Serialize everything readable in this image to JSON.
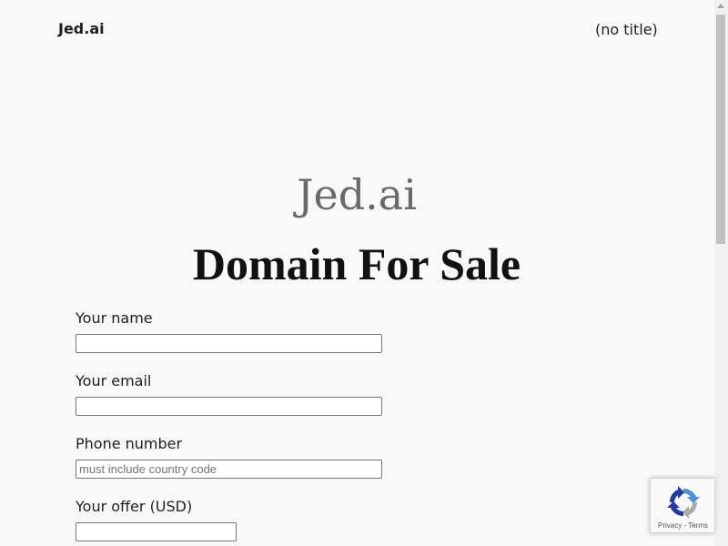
{
  "header": {
    "site_title": "Jed.ai",
    "nav_link": "(no title)"
  },
  "hero": {
    "brand": "Jed.ai",
    "headline": "Domain For Sale"
  },
  "form": {
    "name": {
      "label": "Your name",
      "value": "",
      "placeholder": ""
    },
    "email": {
      "label": "Your email",
      "value": "",
      "placeholder": ""
    },
    "phone": {
      "label": "Phone number",
      "value": "",
      "placeholder": "must include country code"
    },
    "offer": {
      "label": "Your offer (USD)",
      "value": "",
      "placeholder": ""
    }
  },
  "recaptcha": {
    "privacy": "Privacy",
    "separator": " - ",
    "terms": "Terms",
    "colors": {
      "blue": "#1c3aa9",
      "light_blue": "#4a90e2",
      "gray": "#ababab"
    }
  },
  "colors": {
    "background": "#f9f9fa",
    "text": "#1e1e1e",
    "brand_gray": "#6a6a6a"
  }
}
